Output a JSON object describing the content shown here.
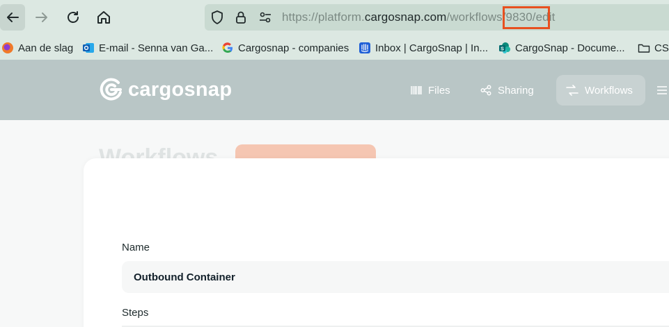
{
  "browser": {
    "url_scheme_prefix": "https://platform.",
    "url_host": "cargosnap.com",
    "url_path": "/workflows/9830/edit",
    "highlight_color": "#e8501f"
  },
  "bookmarks": [
    {
      "label": "Aan de slag",
      "icon": "firefox-icon",
      "color": "#f07a2a"
    },
    {
      "label": "E-mail - Senna van Ga...",
      "icon": "outlook-icon",
      "color": "#1f6fc4"
    },
    {
      "label": "Cargosnap - companies",
      "icon": "google-icon",
      "color": "#4285f4"
    },
    {
      "label": "Inbox | CargoSnap | In...",
      "icon": "intercom-icon",
      "color": "#1f5fd6"
    },
    {
      "label": "CargoSnap - Docume...",
      "icon": "sharepoint-icon",
      "color": "#0c8a7b"
    },
    {
      "label": "CSM",
      "icon": "folder-icon",
      "color": "#3b3b3b"
    }
  ],
  "app": {
    "brand": "cargosnap",
    "nav": [
      {
        "label": "Files",
        "icon": "barcode-icon",
        "active": false
      },
      {
        "label": "Sharing",
        "icon": "share-icon",
        "active": false
      },
      {
        "label": "Workflows",
        "icon": "workflow-icon",
        "active": true
      }
    ],
    "header_color": "#b9c6c6"
  },
  "page": {
    "title": "Workflows",
    "name_label": "Name",
    "name_value": "Outbound Container",
    "steps_label": "Steps"
  }
}
